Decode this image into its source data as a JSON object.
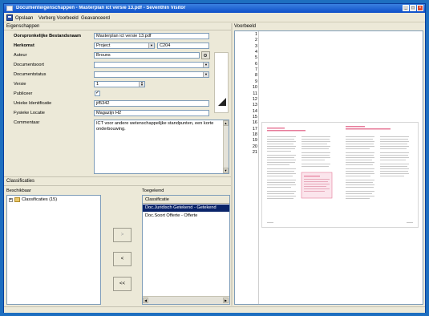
{
  "window": {
    "title": "Documenteigenschappen - Masterplan ict versie 13.pdf - Seventhin Visitor",
    "controls": [
      "_",
      "□",
      "×"
    ]
  },
  "toolbar": {
    "save_label": "Opslaan",
    "hide_preview_label": "Verberg Voorbeeld",
    "advanced_label": "Geavanceerd"
  },
  "properties": {
    "group_title": "Eigenschappen",
    "original_filename_label": "Oorspronkelijke Bestandsnaam",
    "original_filename_value": "Masterplan ict versie 13.pdf",
    "origin_label": "Herkomst",
    "origin_value": "Project",
    "origin_code": "C204",
    "author_label": "Auteur",
    "author_value": "Brouns",
    "doctype_label": "Documentsoort",
    "doctype_value": "",
    "docstatus_label": "Documentstatus",
    "docstatus_value": "",
    "version_label": "Versie",
    "version_value": "1",
    "publish_label": "Publiceer",
    "publish_checked": "✓",
    "unique_id_label": "Unieke Identificatie",
    "unique_id_value": "jif5342",
    "physical_location_label": "Fysieke Locatie",
    "physical_location_value": "Magazijn H2",
    "comment_label": "Commentaar",
    "comment_value": "ICT voor andere wetenschappelijke standpunten, een korte onderbouwing."
  },
  "classification": {
    "group_title": "Classificaties",
    "available_label": "Beschikbaar",
    "assigned_label": "Toegekend",
    "tree_root": "Classificaties (15)",
    "assigned_header": "Classificatie",
    "assigned_items": [
      "Doc.Juridisch Getekend - Getekend",
      "Doc.Soort Offerte - Offerte"
    ],
    "buttons": [
      ">",
      "<",
      "<<"
    ]
  },
  "preview": {
    "group_title": "Voorbeeld",
    "line_numbers": [
      "1",
      "2",
      "3",
      "4",
      "5",
      "6",
      "7",
      "8",
      "9",
      "10",
      "11",
      "12",
      "13",
      "14",
      "15",
      "16",
      "17",
      "18",
      "19",
      "20",
      "21"
    ]
  },
  "colors": {
    "titlebar": "#0d4fc8",
    "selection": "#0a246a",
    "accent_pink": "#e77b9a"
  }
}
